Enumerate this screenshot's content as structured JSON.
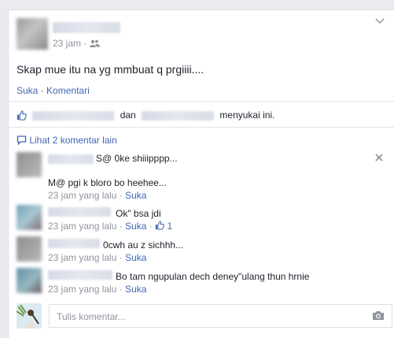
{
  "post": {
    "time": "23 jam",
    "text": "Skap mue itu na yg mmbuat q prgiiii....",
    "actions": {
      "like": "Suka",
      "comment": "Komentari"
    }
  },
  "likes": {
    "and_text": "dan",
    "suffix": "menyukai ini."
  },
  "view_more": "Lihat 2 komentar lain",
  "comments": [
    {
      "text": "S@ 0ke shiiipppp...",
      "text2": "M@ pgi k bloro bo heehee...",
      "time": "23 jam yang lalu",
      "like": "Suka"
    },
    {
      "text": "Ok\" bsa jdi",
      "time": "23 jam yang lalu",
      "like": "Suka",
      "like_count": "1"
    },
    {
      "text": "0cwh au z sichhh...",
      "time": "23 jam yang lalu",
      "like": "Suka"
    },
    {
      "text": "Bo tam ngupulan dech deney\"ulang thun hrnie",
      "time": "23 jam yang lalu",
      "like": "Suka"
    }
  ],
  "composer": {
    "placeholder": "Tulis komentar..."
  },
  "icons": {
    "audience": "friends-icon",
    "menu": "chevron-down-icon",
    "like": "thumbs-up-icon",
    "comment": "speech-bubble-icon",
    "close": "close-icon",
    "camera": "camera-icon"
  },
  "colors": {
    "link": "#4267b2",
    "meta": "#90949c",
    "text": "#1d2129"
  }
}
